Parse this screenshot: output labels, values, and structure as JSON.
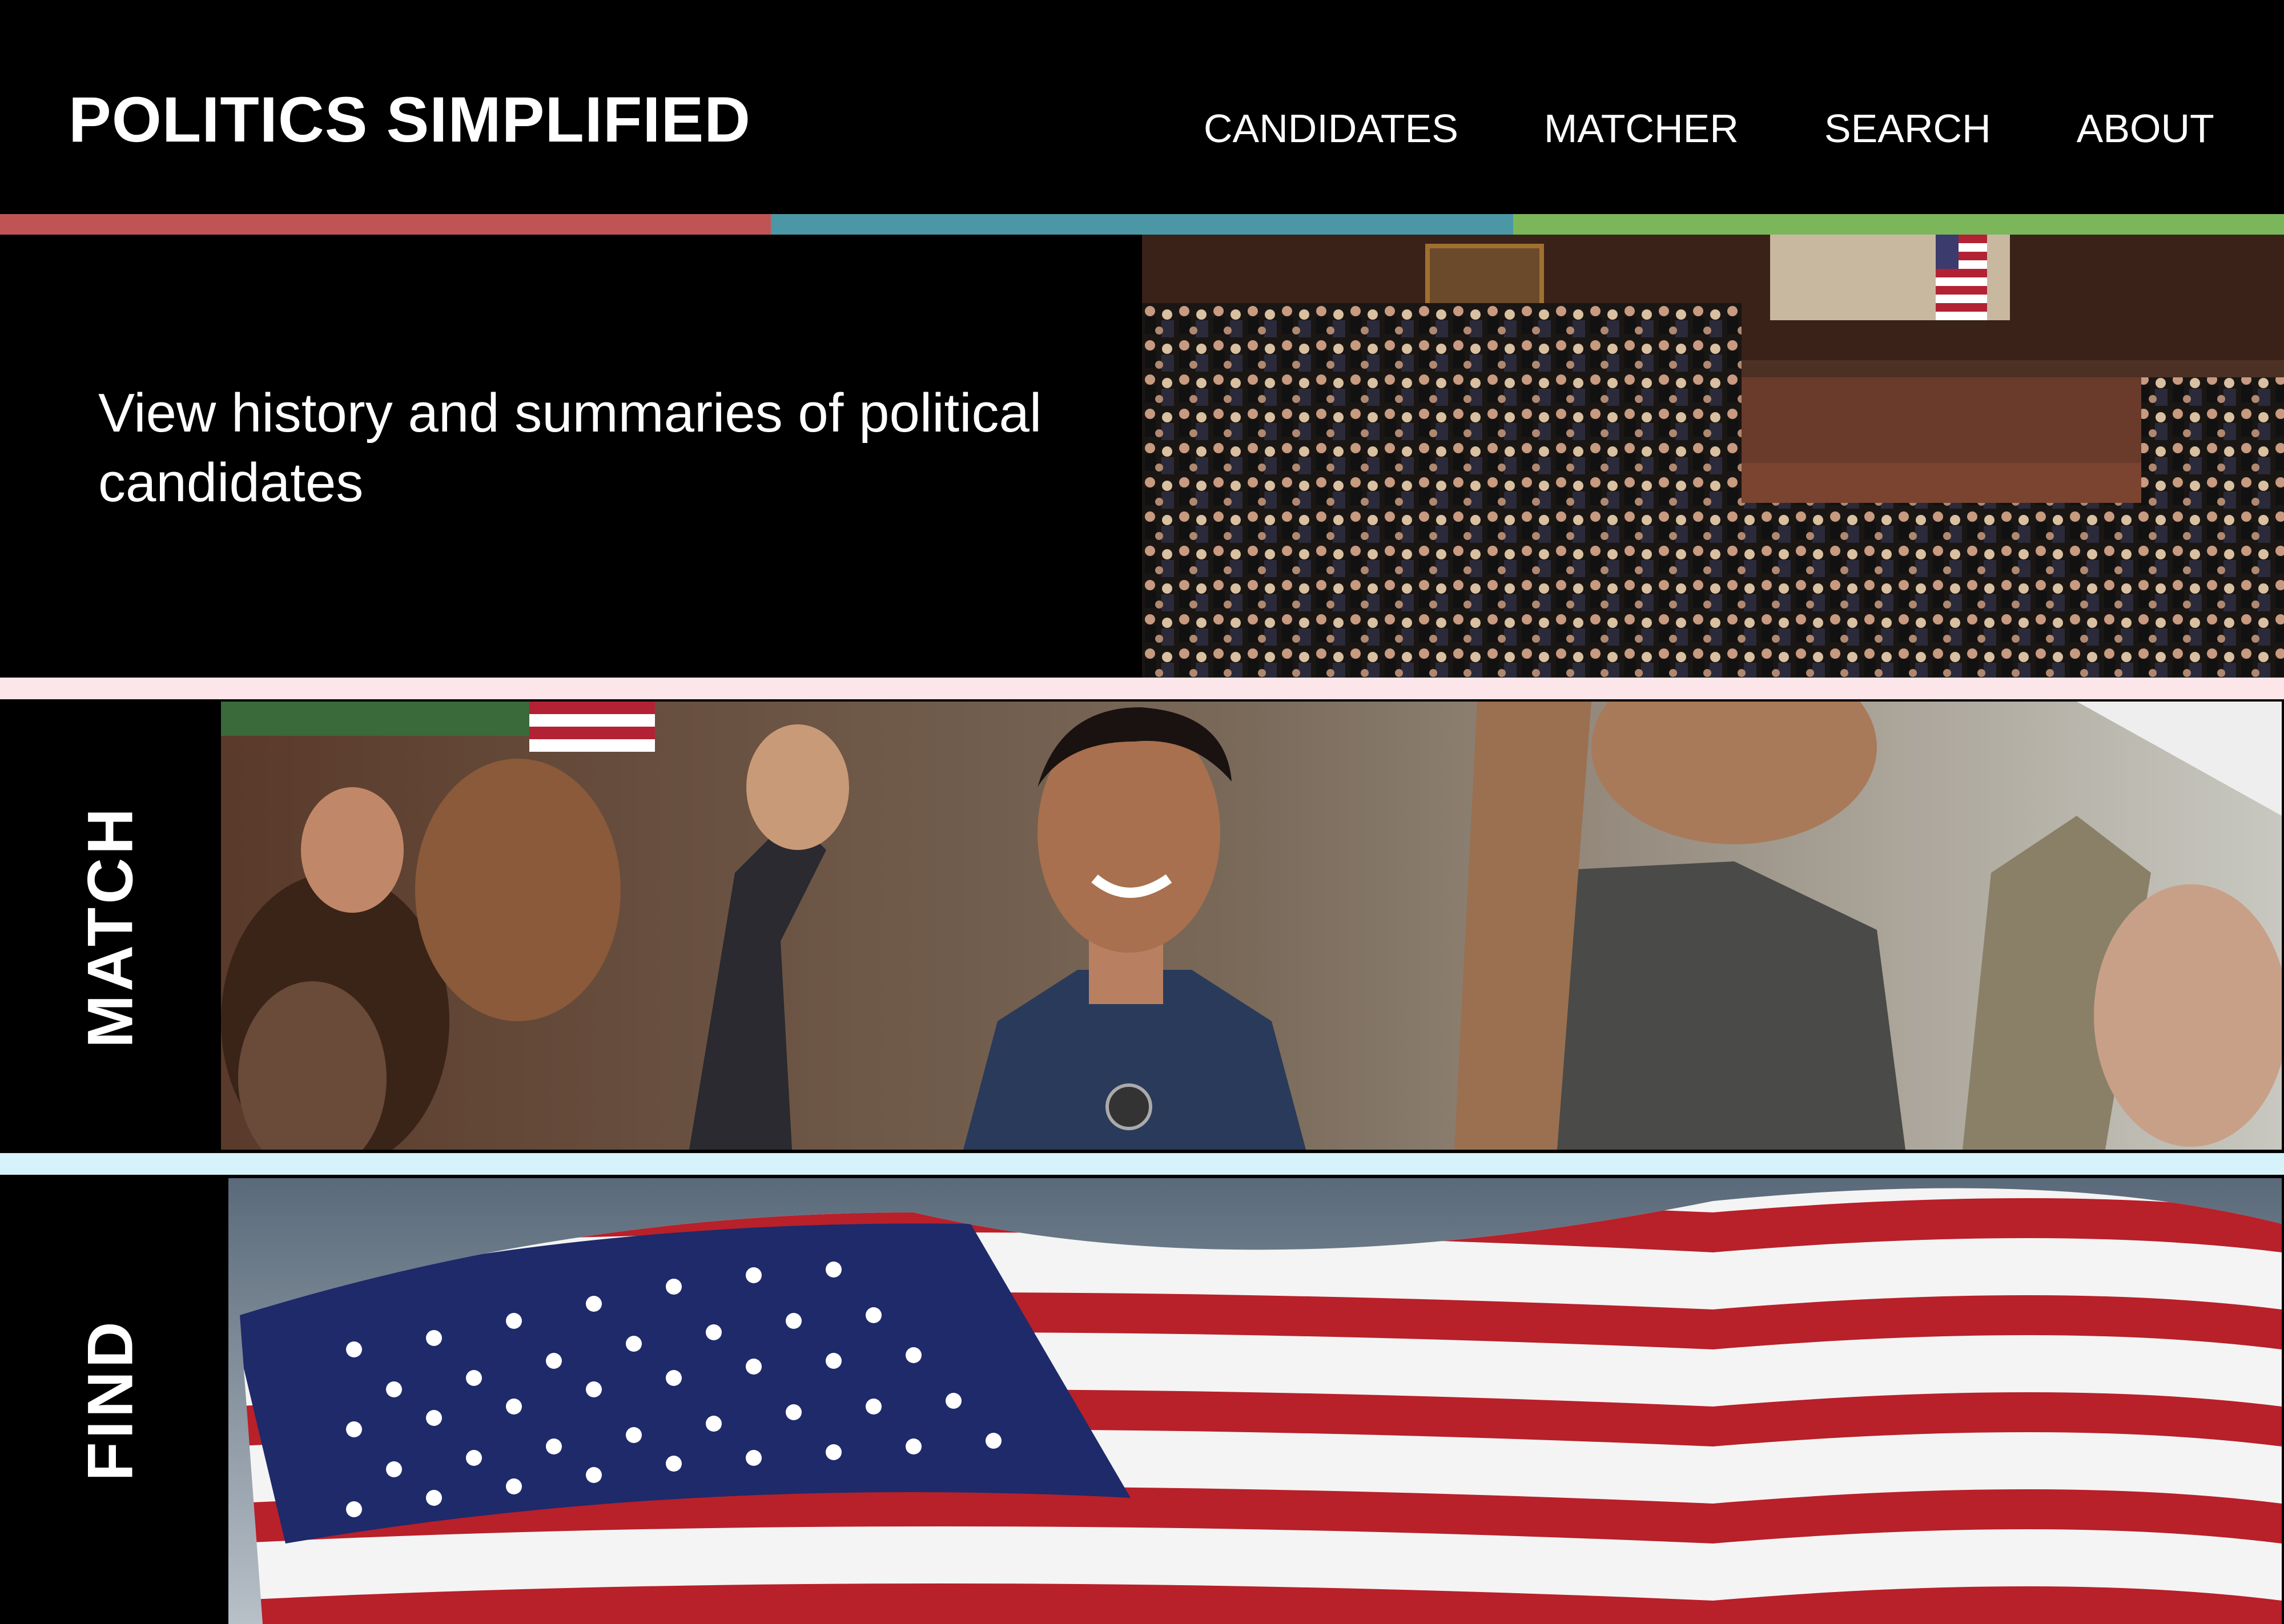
{
  "header": {
    "logo": "POLITICS SIMPLIFIED",
    "nav": [
      {
        "label": "CANDIDATES"
      },
      {
        "label": "MATCHER"
      },
      {
        "label": "SEARCH"
      },
      {
        "label": "ABOUT"
      }
    ]
  },
  "colors": {
    "bar_red": "#c05454",
    "bar_teal": "#4c97a6",
    "bar_green": "#7cb65a",
    "divider_pink": "#fde6ea",
    "divider_blue": "#d6f2fb"
  },
  "sections": [
    {
      "id": "view",
      "text": "View history and summaries of political candidates",
      "image": "house-chamber-photo"
    },
    {
      "id": "match",
      "label": "MATCH",
      "image": "cheering-crowd-photo"
    },
    {
      "id": "find",
      "label": "FIND",
      "image": "american-flag-photo"
    }
  ]
}
